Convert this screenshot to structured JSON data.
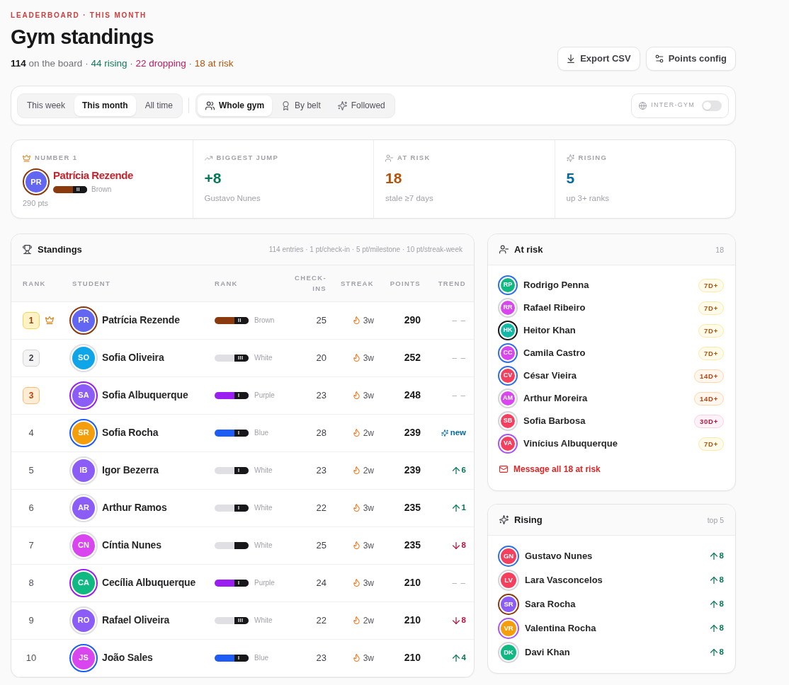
{
  "header": {
    "eyebrow": "LEADERBOARD · THIS MONTH",
    "title": "Gym standings",
    "summary": {
      "separator": "·",
      "items": [
        {
          "text": "**114** on the board",
          "kind": "neutral"
        },
        {
          "text": "44 rising",
          "kind": "up"
        },
        {
          "text": "22 dropping",
          "kind": "down"
        },
        {
          "text": "18 at risk",
          "kind": "risk"
        }
      ]
    }
  },
  "actions": [
    {
      "kind": "export",
      "label": "Export CSV"
    },
    {
      "kind": "config",
      "label": "Points config"
    }
  ],
  "filters": {
    "periods": [
      {
        "label": "This week",
        "selected": false
      },
      {
        "label": "This month",
        "selected": true
      },
      {
        "label": "All time",
        "selected": false
      }
    ],
    "scopes": [
      {
        "kind": "all",
        "label": "Whole gym",
        "selected": true
      },
      {
        "kind": "belt",
        "label": "By belt",
        "selected": false
      },
      {
        "kind": "followed",
        "label": "Followed",
        "selected": false
      }
    ],
    "inter_gym": {
      "label": "INTER-GYM",
      "on": false
    }
  },
  "highlights": [
    {
      "kind": "leader",
      "label": "NUMBER 1",
      "initials": "PR",
      "name": "Patrícia Rezende",
      "color": "#6366f1",
      "belt": {
        "label": "Brown",
        "color": "#8a3a0c",
        "stripes": "II"
      },
      "note": "290 pts"
    },
    {
      "kind": "jump",
      "label": "BIGGEST JUMP",
      "value": "+8",
      "note": "Gustavo Nunes"
    },
    {
      "kind": "risk",
      "label": "AT RISK",
      "value": "18",
      "note": "stale ≥7 days"
    },
    {
      "kind": "rising",
      "label": "RISING",
      "value": "5",
      "note": "up 3+ ranks"
    }
  ],
  "standings": {
    "title": "Standings",
    "meta": "114 entries · 1 pt/check-in · 5 pt/milestone · 10 pt/streak-week",
    "columns": [
      "RANK",
      "STUDENT",
      "RANK",
      "CHECK-INS",
      "STREAK",
      "POINTS",
      "TREND"
    ],
    "rows": [
      {
        "rank": "1",
        "kind": "gold",
        "crown": true,
        "initials": "PR",
        "name": "Patrícia Rezende",
        "color": "#6366f1",
        "belt": {
          "label": "Brown",
          "color": "#8a3a0c",
          "stripes": "II"
        },
        "checkins": "25",
        "streak": "3w",
        "points": "290",
        "trend": {
          "kind": "flat",
          "text": "– –"
        }
      },
      {
        "rank": "2",
        "kind": "silver",
        "crown": false,
        "initials": "SO",
        "name": "Sofia Oliveira",
        "color": "#0ea5e9",
        "belt": {
          "label": "White",
          "color": "#e0e0e4",
          "stripes": "III"
        },
        "checkins": "20",
        "streak": "3w",
        "points": "252",
        "trend": {
          "kind": "flat",
          "text": "– –"
        }
      },
      {
        "rank": "3",
        "kind": "bronze",
        "crown": false,
        "initials": "SA",
        "name": "Sofia Albuquerque",
        "color": "#8b5cf6",
        "belt": {
          "label": "Purple",
          "color": "#9b1ef0",
          "stripes": "I"
        },
        "checkins": "23",
        "streak": "3w",
        "points": "248",
        "trend": {
          "kind": "flat",
          "text": "– –"
        }
      },
      {
        "rank": "4",
        "kind": "plain",
        "crown": false,
        "initials": "SR",
        "name": "Sofia Rocha",
        "color": "#f59e0b",
        "belt": {
          "label": "Blue",
          "color": "#1d5cf5",
          "stripes": "I"
        },
        "checkins": "28",
        "streak": "2w",
        "points": "239",
        "trend": {
          "kind": "new",
          "text": "new"
        }
      },
      {
        "rank": "5",
        "kind": "plain",
        "crown": false,
        "initials": "IB",
        "name": "Igor Bezerra",
        "color": "#8b5cf6",
        "belt": {
          "label": "White",
          "color": "#e0e0e4",
          "stripes": "I"
        },
        "checkins": "23",
        "streak": "2w",
        "points": "239",
        "trend": {
          "kind": "up",
          "text": "6"
        }
      },
      {
        "rank": "6",
        "kind": "plain",
        "crown": false,
        "initials": "AR",
        "name": "Arthur Ramos",
        "color": "#8b5cf6",
        "belt": {
          "label": "White",
          "color": "#e0e0e4",
          "stripes": "I"
        },
        "checkins": "22",
        "streak": "3w",
        "points": "235",
        "trend": {
          "kind": "up",
          "text": "1"
        }
      },
      {
        "rank": "7",
        "kind": "plain",
        "crown": false,
        "initials": "CN",
        "name": "Cíntia Nunes",
        "color": "#d946ef",
        "belt": {
          "label": "White",
          "color": "#e0e0e4"
        },
        "checkins": "25",
        "streak": "3w",
        "points": "235",
        "trend": {
          "kind": "down",
          "text": "8"
        }
      },
      {
        "rank": "8",
        "kind": "plain",
        "crown": false,
        "initials": "CA",
        "name": "Cecília Albuquerque",
        "color": "#10b981",
        "belt": {
          "label": "Purple",
          "color": "#9b1ef0",
          "stripes": "I"
        },
        "checkins": "24",
        "streak": "3w",
        "points": "210",
        "trend": {
          "kind": "flat",
          "text": "– –"
        }
      },
      {
        "rank": "9",
        "kind": "plain",
        "crown": false,
        "initials": "RO",
        "name": "Rafael Oliveira",
        "color": "#8b5cf6",
        "belt": {
          "label": "White",
          "color": "#e0e0e4",
          "stripes": "III"
        },
        "checkins": "22",
        "streak": "2w",
        "points": "210",
        "trend": {
          "kind": "down",
          "text": "8"
        }
      },
      {
        "rank": "10",
        "kind": "plain",
        "crown": false,
        "initials": "JS",
        "name": "João Sales",
        "color": "#d946ef",
        "belt": {
          "label": "Blue",
          "color": "#1d5cf5",
          "stripes": "I"
        },
        "checkins": "23",
        "streak": "3w",
        "points": "210",
        "trend": {
          "kind": "up",
          "text": "4"
        }
      }
    ]
  },
  "at_risk": {
    "title": "At risk",
    "count": "18",
    "items": [
      {
        "initials": "RP",
        "name": "Rodrigo Penna",
        "color": "#10b981",
        "ring": {
          "color": "#2f6fe8"
        },
        "badge": "7D+",
        "kind": "mild"
      },
      {
        "initials": "RR",
        "name": "Rafael Ribeiro",
        "color": "#d946ef",
        "ring": {
          "color": "#d4d4d8"
        },
        "badge": "7D+",
        "kind": "mild"
      },
      {
        "initials": "HK",
        "name": "Heitor Khan",
        "color": "#14b8a6",
        "ring": {
          "color": "#18181b"
        },
        "badge": "7D+",
        "kind": "mild"
      },
      {
        "initials": "CC",
        "name": "Camila Castro",
        "color": "#d946ef",
        "ring": {
          "color": "#2f6fe8"
        },
        "badge": "7D+",
        "kind": "mild"
      },
      {
        "initials": "CV",
        "name": "César Vieira",
        "color": "#f43f5e",
        "ring": {
          "color": "#2f6fe8"
        },
        "badge": "14D+",
        "kind": "moderate"
      },
      {
        "initials": "AM",
        "name": "Arthur Moreira",
        "color": "#d946ef",
        "ring": {
          "color": "#d4d4d8"
        },
        "badge": "14D+",
        "kind": "moderate"
      },
      {
        "initials": "SB",
        "name": "Sofia Barbosa",
        "color": "#f43f5e",
        "ring": {
          "color": "#d4d4d8"
        },
        "badge": "30D+",
        "kind": "severe"
      },
      {
        "initials": "VA",
        "name": "Vinícius Albuquerque",
        "color": "#f43f5e",
        "ring": {
          "color": "#a855f7"
        },
        "badge": "7D+",
        "kind": "mild"
      }
    ],
    "action": "Message all 18 at risk"
  },
  "rising": {
    "title": "Rising",
    "note": "top 5",
    "items": [
      {
        "initials": "GN",
        "name": "Gustavo Nunes",
        "color": "#f43f5e",
        "ring": {
          "color": "#2f6fe8"
        },
        "change": "8"
      },
      {
        "initials": "LV",
        "name": "Lara Vasconcelos",
        "color": "#f43f5e",
        "ring": {
          "color": "#d4d4d8"
        },
        "change": "8"
      },
      {
        "initials": "SR",
        "name": "Sara Rocha",
        "color": "#8b5cf6",
        "ring": {
          "color": "#8a3a0c"
        },
        "change": "8"
      },
      {
        "initials": "VR",
        "name": "Valentina Rocha",
        "color": "#f59e0b",
        "ring": {
          "color": "#a855f7"
        },
        "change": "8"
      },
      {
        "initials": "DK",
        "name": "Davi Khan",
        "color": "#10b981",
        "ring": {
          "color": "#d4d4d8"
        },
        "change": "8"
      }
    ]
  }
}
